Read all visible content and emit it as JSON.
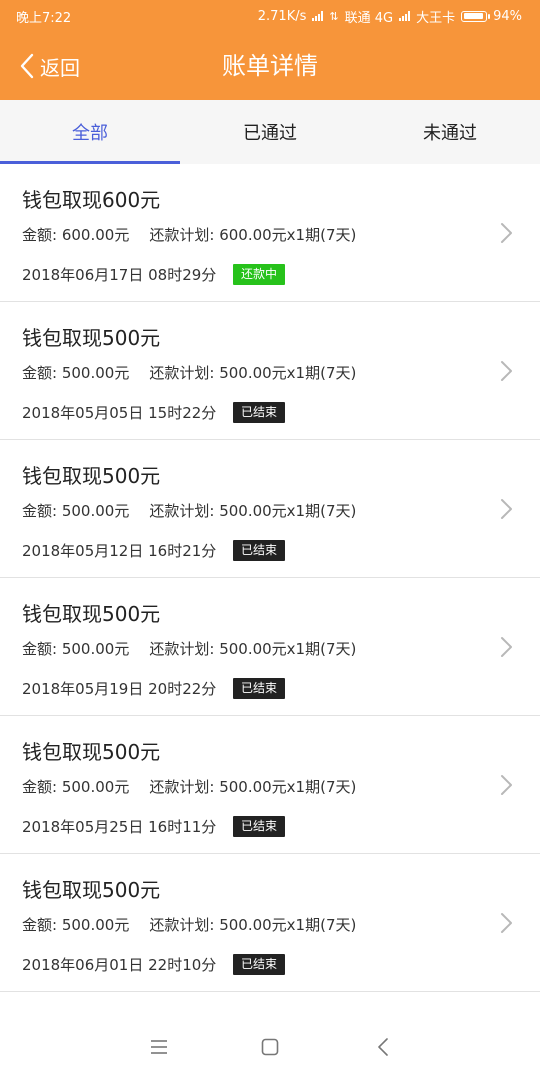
{
  "status_bar": {
    "time": "晚上7:22",
    "speed": "2.71K/s",
    "carrier1": "联通 4G",
    "carrier2": "大王卡",
    "battery": "94%",
    "battery_level": 0.94
  },
  "header": {
    "back_label": "返回",
    "title": "账单详情",
    "background": "#f7953a"
  },
  "tabs": [
    {
      "label": "全部",
      "active": true
    },
    {
      "label": "已通过",
      "active": false
    },
    {
      "label": "未通过",
      "active": false
    }
  ],
  "accent_color": "#4a5fd9",
  "status_colors": {
    "还款中": "#27c21b",
    "已结束": "#222222"
  },
  "items": [
    {
      "title": "钱包取现600元",
      "amount_label": "金额:",
      "amount": "600.00元",
      "plan_label": "还款计划:",
      "plan": "600.00元x1期(7天)",
      "date": "2018年06月17日 08时29分",
      "status": "还款中"
    },
    {
      "title": "钱包取现500元",
      "amount_label": "金额:",
      "amount": "500.00元",
      "plan_label": "还款计划:",
      "plan": "500.00元x1期(7天)",
      "date": "2018年05月05日 15时22分",
      "status": "已结束"
    },
    {
      "title": "钱包取现500元",
      "amount_label": "金额:",
      "amount": "500.00元",
      "plan_label": "还款计划:",
      "plan": "500.00元x1期(7天)",
      "date": "2018年05月12日 16时21分",
      "status": "已结束"
    },
    {
      "title": "钱包取现500元",
      "amount_label": "金额:",
      "amount": "500.00元",
      "plan_label": "还款计划:",
      "plan": "500.00元x1期(7天)",
      "date": "2018年05月19日 20时22分",
      "status": "已结束"
    },
    {
      "title": "钱包取现500元",
      "amount_label": "金额:",
      "amount": "500.00元",
      "plan_label": "还款计划:",
      "plan": "500.00元x1期(7天)",
      "date": "2018年05月25日 16时11分",
      "status": "已结束"
    },
    {
      "title": "钱包取现500元",
      "amount_label": "金额:",
      "amount": "500.00元",
      "plan_label": "还款计划:",
      "plan": "500.00元x1期(7天)",
      "date": "2018年06月01日 22时10分",
      "status": "已结束"
    }
  ],
  "icons": {
    "back": "chevron-left-icon",
    "item_arrow": "chevron-right-icon",
    "nav_menu": "menu-icon",
    "nav_home": "home-square-icon",
    "nav_back": "back-triangle-icon"
  }
}
